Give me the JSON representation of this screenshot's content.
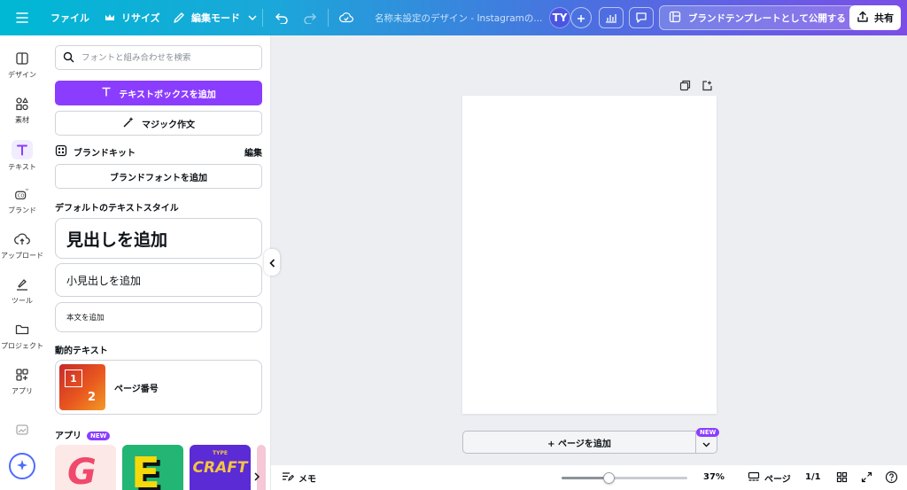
{
  "topbar": {
    "file_label": "ファイル",
    "resize_label": "リサイズ",
    "mode_label": "編集モード",
    "doc_title": "名称未設定のデザイン - Instagramの...",
    "avatar_initials": "TY",
    "publish_label": "ブランドテンプレートとして公開する",
    "share_label": "共有"
  },
  "rail": {
    "items": [
      {
        "label": "デザイン",
        "icon": "layout-icon"
      },
      {
        "label": "素材",
        "icon": "shapes-icon"
      },
      {
        "label": "テキスト",
        "icon": "text-icon"
      },
      {
        "label": "ブランド",
        "icon": "brand-icon"
      },
      {
        "label": "アップロード",
        "icon": "cloud-upload-icon"
      },
      {
        "label": "ツール",
        "icon": "draw-icon"
      },
      {
        "label": "プロジェクト",
        "icon": "folder-icon"
      },
      {
        "label": "アプリ",
        "icon": "apps-icon"
      }
    ]
  },
  "panel": {
    "search_placeholder": "フォントと組み合わせを検索",
    "add_textbox": "テキストボックスを追加",
    "magic_write": "マジック作文",
    "brand_kit": "ブランドキット",
    "brand_edit": "編集",
    "add_brand_font": "ブランドフォントを追加",
    "default_styles_title": "デフォルトのテキストスタイル",
    "heading": "見出しを追加",
    "subheading": "小見出しを追加",
    "body": "本文を追加",
    "dynamic_title": "動的テキスト",
    "page_number": "ページ番号",
    "thumb_num1": "1",
    "thumb_num2": "2",
    "apps_title": "アプリ",
    "new_badge": "NEW",
    "app_craft": "CRAFT",
    "app_type": "TYPE",
    "app_e": "E",
    "app_g": "G"
  },
  "canvas": {
    "add_page": "+ ページを追加",
    "new_badge": "NEW"
  },
  "bottombar": {
    "notes": "メモ",
    "zoom": "37%",
    "zoom_fraction": 0.37,
    "pages": "ページ",
    "page_count": "1/1"
  },
  "colors": {
    "accent": "#8b3dff",
    "blue": "#4d6bff"
  }
}
